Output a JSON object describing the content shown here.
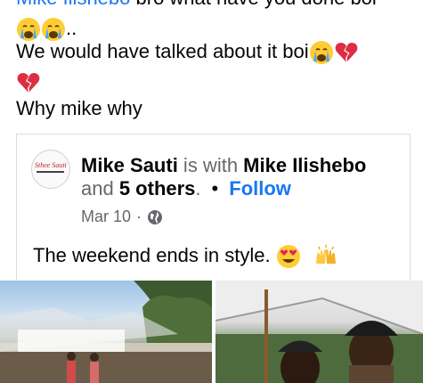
{
  "post": {
    "line1_link": "Mike Ilishebo",
    "line1_text": " bro what have you done boi",
    "line2_text": "..",
    "line3_text": "We would have talked about it boi",
    "line5_text": "Why mike why"
  },
  "shared": {
    "author": "Mike Sauti",
    "is_with": " is with ",
    "with_name": "Mike Ilishebo",
    "and_text": "and ",
    "others": "5 others",
    "period": ".",
    "dot": "•",
    "follow": "Follow",
    "date": "Mar 10",
    "date_sep": "·",
    "body": "The weekend ends in style.",
    "avatar_text": "Sthee Sauti"
  },
  "colors": {
    "link": "#1877f2",
    "text": "#050505",
    "muted": "#65676b",
    "border": "#dadde1"
  },
  "icons": [
    "crying-face-icon",
    "broken-heart-icon",
    "heart-eyes-icon",
    "raised-hands-icon",
    "globe-icon"
  ]
}
